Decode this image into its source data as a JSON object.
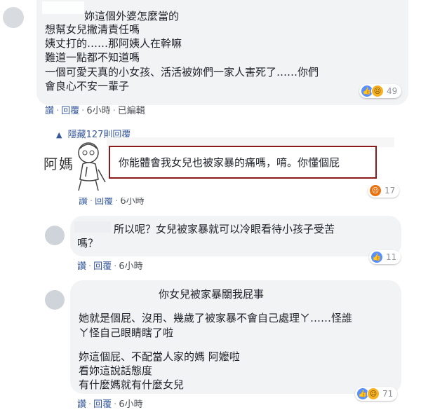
{
  "comment1": {
    "lines": [
      "妳這個外婆怎麼當的",
      "想幫女兒撇清責任嗎",
      "姨丈打的……那阿姨人在幹嘛",
      "難道一點都不知道嗎",
      "一個可愛天真的小女孩、活活被妳們一家人害死了……你們",
      "會良心不安一輩子"
    ],
    "actions": {
      "like": "讚",
      "reply": "回覆",
      "time": "6小時",
      "edited": "已編輯"
    },
    "reaction_count": "49"
  },
  "hidden_replies": {
    "label": "隱藏127則回覆"
  },
  "comment2": {
    "name_handwritten": "阿媽",
    "text": "你能體會我女兒也被家暴的痛嗎，唷。你懂個屁",
    "actions": {
      "like": "讚",
      "reply": "回覆",
      "time": "6小時"
    },
    "reaction_count": "17"
  },
  "comment3": {
    "lines": [
      "所以呢？女兒被家暴就可以冷眼看待小孩子受苦",
      "嗎？"
    ],
    "actions": {
      "like": "讚",
      "reply": "回覆",
      "time": "6小時"
    },
    "reaction_count": "11"
  },
  "comment4": {
    "title": "你女兒被家暴關我屁事",
    "para1": [
      "她就是個屁、沒用、幾歲了被家暴不會自己處理ㄚ……怪誰",
      "ㄚ怪自己眼睛瞎了啦"
    ],
    "para2": [
      "妳這個屁、不配當人家的媽 阿嬤啦",
      "看妳這說話態度",
      "有什麼媽就有什麼女兒"
    ],
    "actions": {
      "like": "讚",
      "reply": "回覆",
      "time": "6小時"
    },
    "reaction_count": "71"
  },
  "colors": {
    "link": "#365899",
    "bubble": "#f2f3f5",
    "highlight_border": "#8b1a1a"
  }
}
